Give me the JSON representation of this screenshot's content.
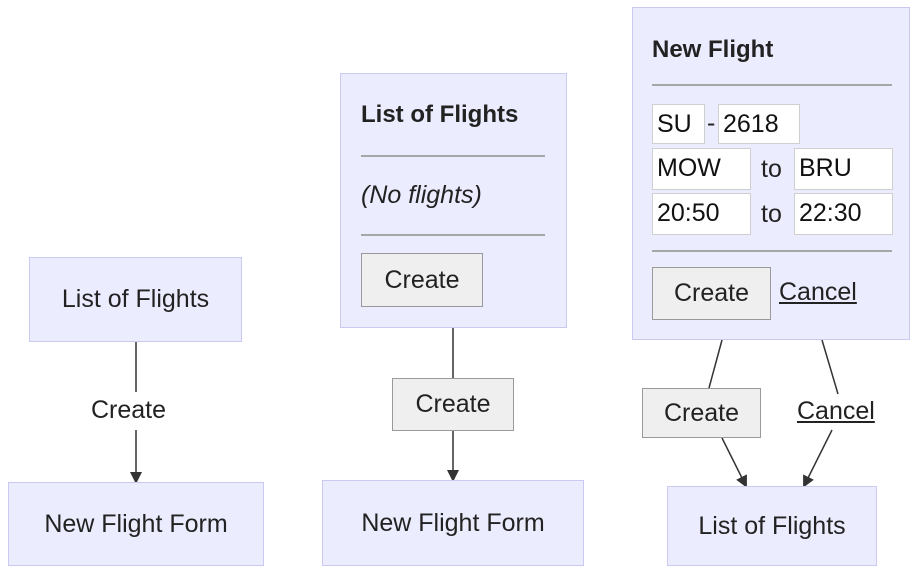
{
  "diagram1": {
    "top_node": "List of Flights",
    "edge_label": "Create",
    "bottom_node": "New Flight Form"
  },
  "diagram2": {
    "title": "List of Flights",
    "empty_text": "(No flights)",
    "create_button": "Create",
    "edge_button": "Create",
    "bottom_node": "New Flight Form"
  },
  "diagram3": {
    "title": "New Flight",
    "airline": "SU",
    "dash": "-",
    "number": "2618",
    "from_city": "MOW",
    "to_word_1": "to",
    "to_city": "BRU",
    "depart_time": "20:50",
    "to_word_2": "to",
    "arrive_time": "22:30",
    "create_button": "Create",
    "cancel_link": "Cancel",
    "edge_create": "Create",
    "edge_cancel": "Cancel",
    "bottom_node": "List of Flights"
  }
}
